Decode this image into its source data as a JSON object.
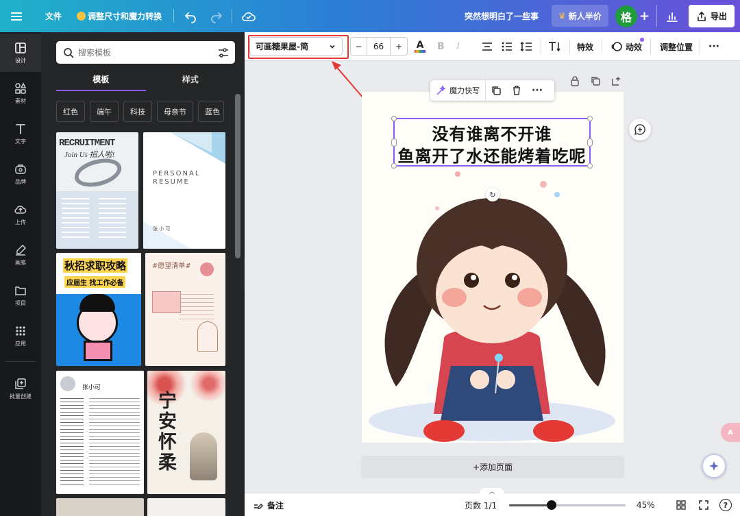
{
  "topbar": {
    "file": "文件",
    "resize": "调整尺寸和魔力转换",
    "doc_title": "突然想明白了一些事",
    "promo": "新人半价",
    "avatar_letter": "格",
    "export": "导出"
  },
  "rail": [
    {
      "label": "设计",
      "icon": "layout-icon"
    },
    {
      "label": "素材",
      "icon": "shapes-icon"
    },
    {
      "label": "文字",
      "icon": "text-icon"
    },
    {
      "label": "品牌",
      "icon": "brand-icon"
    },
    {
      "label": "上传",
      "icon": "upload-icon"
    },
    {
      "label": "画笔",
      "icon": "pen-icon"
    },
    {
      "label": "项目",
      "icon": "folder-icon"
    },
    {
      "label": "应用",
      "icon": "apps-icon"
    },
    {
      "label": "批量创建",
      "icon": "bulk-create-icon"
    }
  ],
  "panel": {
    "search_placeholder": "搜索模板",
    "tabs": [
      "模板",
      "样式"
    ],
    "chips": [
      "红色",
      "端午",
      "科技",
      "母亲节",
      "蓝色"
    ],
    "cards": {
      "recruit_title": "RECRUITMENT",
      "recruit_sub": "Join Us 招人啦!",
      "resume_title": "PERSONAL",
      "resume_title2": "RESUME",
      "resume_name": "张 小 可",
      "autumn_title": "秋招求职攻略",
      "autumn_sub": "应届生 找工作必备",
      "wish_title": "#愿望清单#",
      "cv_name": "张小可",
      "ink_title": "宁安怀柔"
    }
  },
  "toolbar": {
    "font": "可画糖果屋-简",
    "minus": "−",
    "font_size": "66",
    "plus": "+",
    "bold": "B",
    "italic": "I",
    "effects": "特效",
    "animate": "动效",
    "position": "调整位置",
    "more": "···"
  },
  "float_toolbar": {
    "magic_write": "魔力快写"
  },
  "canvas": {
    "line1": "没有谁离不开谁",
    "line2": "鱼离开了水还能烤着吃呢",
    "add_page": "+添加页面"
  },
  "bottombar": {
    "notes": "备注",
    "pages": "页数 1/1",
    "zoom": "45%",
    "zoom_level": 0.45
  },
  "colors": {
    "accent": "#8b5cf6",
    "highlight": "#e53935",
    "avatar": "#1f9d3a"
  }
}
